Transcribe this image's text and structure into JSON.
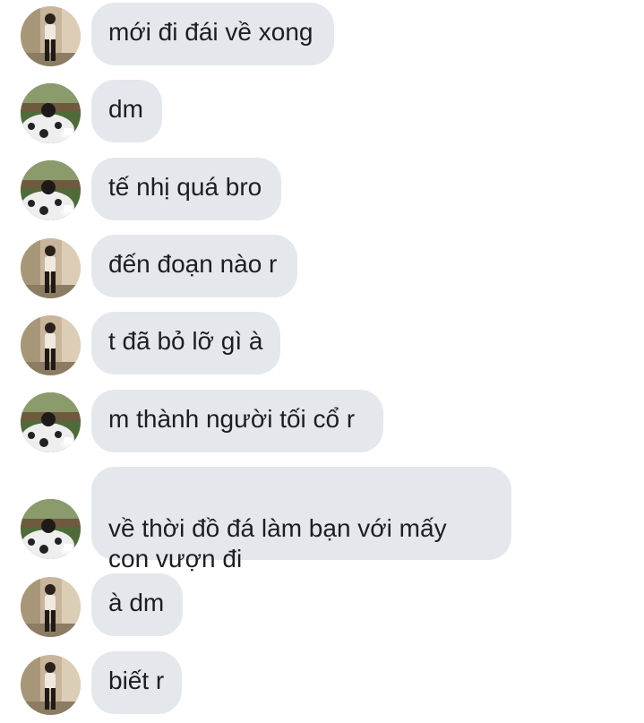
{
  "chat": {
    "messages": [
      {
        "sender": "user-a",
        "text": "mới đi đái về xong"
      },
      {
        "sender": "user-b",
        "text": "dm"
      },
      {
        "sender": "user-b",
        "text": "tế nhị quá bro"
      },
      {
        "sender": "user-a",
        "text": "đến đoạn nào r"
      },
      {
        "sender": "user-a",
        "text": "t đã bỏ lỡ gì à"
      },
      {
        "sender": "user-b",
        "text": "m thành người tối cổ r"
      },
      {
        "sender": "user-b",
        "text": "về thời đồ đá làm bạn với mấy\ncon vượn đi"
      },
      {
        "sender": "user-a",
        "text": "à dm"
      },
      {
        "sender": "user-a",
        "text": "biết r"
      }
    ]
  },
  "colors": {
    "bubble": "#e4e8ed",
    "text": "#1c1e21",
    "background": "#ffffff"
  },
  "icons": {
    "user-a": "avatar-standing-person",
    "user-b": "avatar-seated-person"
  }
}
